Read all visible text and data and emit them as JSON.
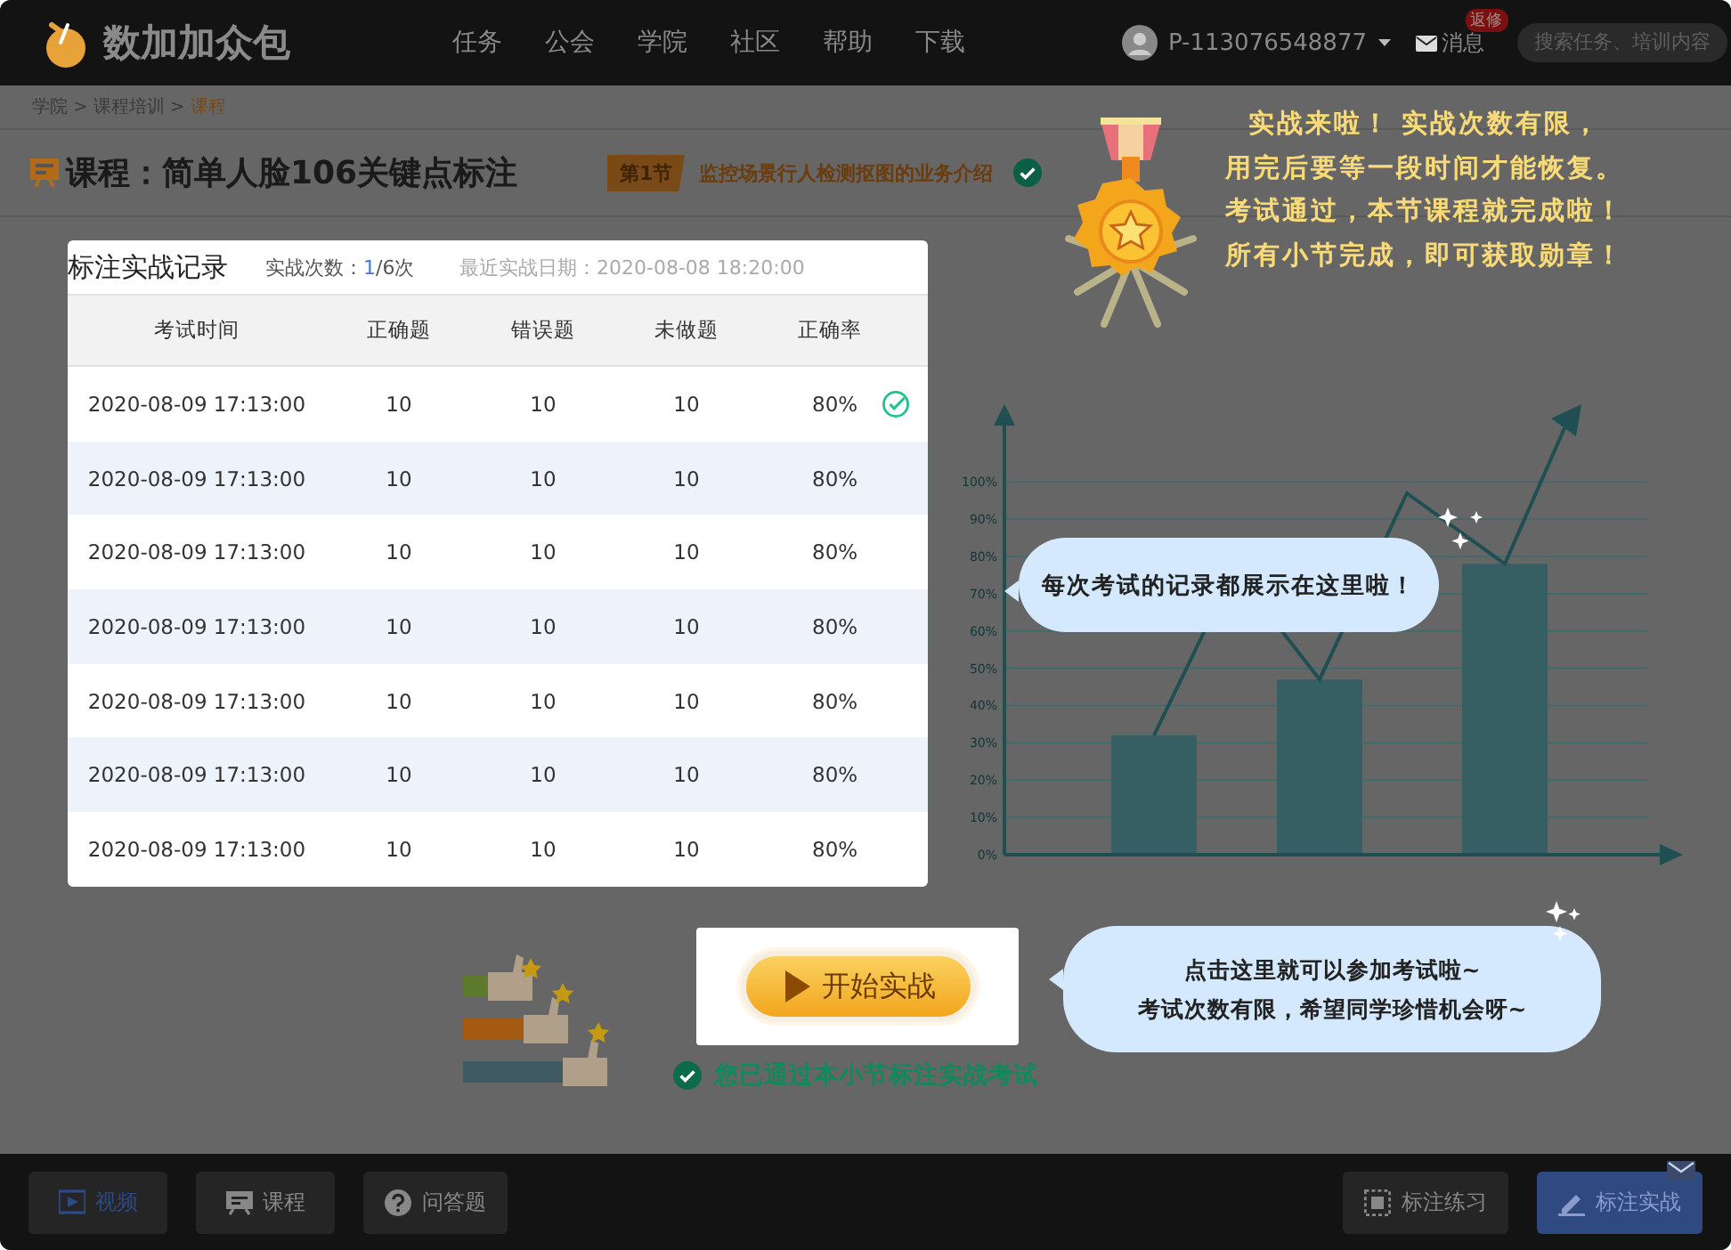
{
  "header": {
    "logo": "数加加众包",
    "nav": [
      {
        "label": "任务"
      },
      {
        "label": "公会"
      },
      {
        "label": "学院"
      },
      {
        "label": "社区"
      },
      {
        "label": "帮助"
      },
      {
        "label": "下载"
      }
    ],
    "user": {
      "name": "P-113076548877"
    },
    "messages": {
      "label": "消息",
      "badge": "返修"
    },
    "search": {
      "placeholder": "搜索任务、培训内容"
    }
  },
  "breadcrumb": {
    "items": [
      {
        "label": "学院",
        "current": false
      },
      {
        "label": "课程培训",
        "current": false
      },
      {
        "label": "课程",
        "current": true
      }
    ],
    "separators": [
      ">",
      ">"
    ]
  },
  "course": {
    "title": "课程：简单人脸106关键点标注",
    "section_badge": "第1节",
    "section_title": "监控场景行人检测抠图的业务介绍",
    "completed": true
  },
  "record_card": {
    "title": "标注实战记录",
    "attempts_label": "实战次数：",
    "attempts_used": "1",
    "attempts_total": "/6次",
    "last_attempt": "最近实战日期：2020-08-08  18:20:00",
    "columns": [
      "考试时间",
      "正确题",
      "错误题",
      "未做题",
      "正确率"
    ],
    "rows": [
      {
        "cells": [
          "2020-08-09 17:13:00",
          "10",
          "10",
          "10",
          "80%"
        ],
        "passed": true
      },
      {
        "cells": [
          "2020-08-09 17:13:00",
          "10",
          "10",
          "10",
          "80%"
        ],
        "passed": false
      },
      {
        "cells": [
          "2020-08-09 17:13:00",
          "10",
          "10",
          "10",
          "80%"
        ],
        "passed": false
      },
      {
        "cells": [
          "2020-08-09 17:13:00",
          "10",
          "10",
          "10",
          "80%"
        ],
        "passed": false
      },
      {
        "cells": [
          "2020-08-09 17:13:00",
          "10",
          "10",
          "10",
          "80%"
        ],
        "passed": false
      },
      {
        "cells": [
          "2020-08-09 17:13:00",
          "10",
          "10",
          "10",
          "80%"
        ],
        "passed": false
      },
      {
        "cells": [
          "2020-08-09 17:13:00",
          "10",
          "10",
          "10",
          "80%"
        ],
        "passed": false
      }
    ]
  },
  "medal_tip": {
    "lines": [
      "实战来啦！ 实战次数有限，",
      "用完后要等一段时间才能恢复。",
      "考试通过，本节课程就完成啦！",
      "所有小节完成，即可获取勋章！"
    ]
  },
  "chart": {
    "chart_data": {
      "type": "bar",
      "values": [
        32,
        47,
        78
      ],
      "ylim": [
        0,
        117
      ],
      "grid": true,
      "yticks": [
        {
          "value": 0,
          "label": "0%"
        },
        {
          "value": 10,
          "label": "10%"
        },
        {
          "value": 20,
          "label": "20%"
        },
        {
          "value": 30,
          "label": "30%"
        },
        {
          "value": 40,
          "label": "40%"
        },
        {
          "value": 50,
          "label": "50%"
        },
        {
          "value": 60,
          "label": "60%"
        },
        {
          "value": 70,
          "label": "70%"
        },
        {
          "value": 80,
          "label": "80%"
        },
        {
          "value": 90,
          "label": "90%"
        },
        {
          "value": 100,
          "label": "100%"
        }
      ]
    }
  },
  "record_tip": {
    "text": "每次考试的记录都展示在这里啦！"
  },
  "start_button": {
    "label": "开始实战"
  },
  "start_tip": {
    "lines": [
      "点击这里就可以参加考试啦~",
      "考试次数有限，希望同学珍惜机会呀~"
    ]
  },
  "passed_notice": {
    "text": "您已通过本小节标注实战考试",
    "passed": true
  },
  "bottom_bar": {
    "left": [
      {
        "kind": "video",
        "label": "视频",
        "selected": true
      },
      {
        "kind": "course",
        "label": "课程",
        "selected": false
      },
      {
        "kind": "qa",
        "label": "问答题",
        "selected": false
      }
    ],
    "right": [
      {
        "kind": "practice",
        "label": "标注练习",
        "selected": false
      },
      {
        "kind": "exam",
        "label": "标注实战",
        "selected": true
      }
    ]
  }
}
